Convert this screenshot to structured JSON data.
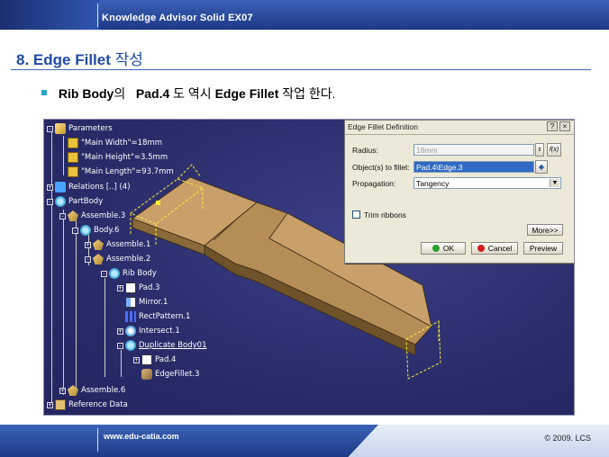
{
  "header": {
    "title": "Knowledge Advisor Solid EX07"
  },
  "slide": {
    "title_num": "8.",
    "title_bold": "Edge Fillet",
    "title_kor": "작성",
    "bullet_a": "Rib Body",
    "bullet_b": "의",
    "bullet_c": "Pad.4",
    "bullet_d": "도 역시",
    "bullet_e": "Edge Fillet",
    "bullet_f": "작업 한다."
  },
  "tree": {
    "parameters": "Parameters",
    "p1": "\"Main Width\"=18mm",
    "p2": "\"Main Height\"=3.5mm",
    "p3": "\"Main Length\"=93.7mm",
    "relations": "Relations [..] (4)",
    "partbody": "PartBody",
    "assemble3": "Assemble.3",
    "body6": "Body.6",
    "assemble1": "Assemble.1",
    "assemble2": "Assemble.2",
    "ribbody": "Rib Body",
    "pad3": "Pad.3",
    "mirror1": "Mirror.1",
    "rectpattern1": "RectPattern.1",
    "intersect1": "Intersect.1",
    "duplicate": "Duplicate Body01",
    "pad4": "Pad.4",
    "edgefillet3": "EdgeFillet.3",
    "assemble6": "Assemble.6",
    "refdata": "Reference Data"
  },
  "dialog": {
    "title": "Edge Fillet Definition",
    "help": "?",
    "close": "×",
    "radius_label": "Radius:",
    "radius_value": "18mm",
    "objects_label": "Object(s) to fillet:",
    "objects_value": "Pad.4\\Edge.3",
    "propagation_label": "Propagation:",
    "propagation_value": "Tangency",
    "trim_label": "Trim ribbons",
    "trim_checked": false,
    "more_button": "More>>",
    "ok_button": "OK",
    "cancel_button": "Cancel",
    "preview_button": "Preview",
    "formula_icon": "f(x)"
  },
  "footer": {
    "url": "www.edu-catia.com",
    "copyright": "© 2009. LCS"
  }
}
